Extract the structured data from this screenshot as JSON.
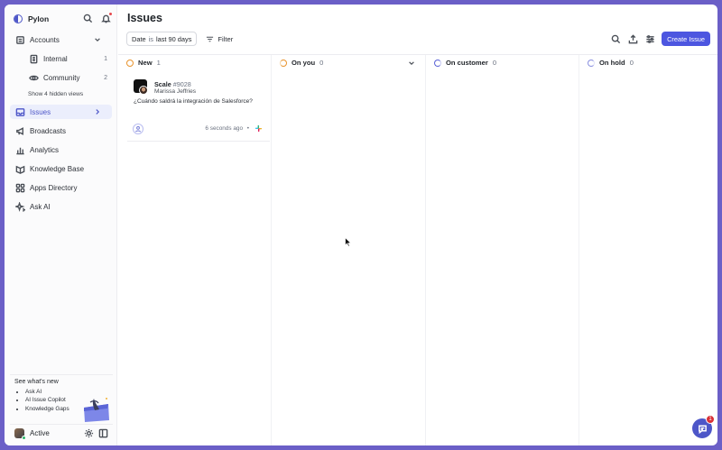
{
  "sidebar": {
    "brand": "Pylon",
    "accounts": {
      "label": "Accounts",
      "views": [
        {
          "label": "Internal",
          "count": "1"
        },
        {
          "label": "Community",
          "count": "2"
        }
      ],
      "hidden_views": "Show 4 hidden views"
    },
    "items": [
      {
        "label": "Issues",
        "icon": "inbox-icon"
      },
      {
        "label": "Broadcasts",
        "icon": "megaphone-icon"
      },
      {
        "label": "Analytics",
        "icon": "bar-chart-icon"
      },
      {
        "label": "Knowledge Base",
        "icon": "book-icon"
      },
      {
        "label": "Apps Directory",
        "icon": "grid-icon"
      },
      {
        "label": "Ask AI",
        "icon": "sparkle-icon"
      }
    ],
    "whats_new": {
      "title": "See what's new",
      "items": [
        "Ask AI",
        "AI Issue Copilot",
        "Knowledge Gaps"
      ]
    },
    "user": {
      "status": "Active"
    }
  },
  "main": {
    "title": "Issues",
    "date_chip": {
      "field": "Date",
      "op": "is",
      "value": "last 90 days"
    },
    "filter_label": "Filter",
    "create_label": "Create Issue",
    "columns": [
      {
        "label": "New",
        "count": "1",
        "color": "#e8932c"
      },
      {
        "label": "On you",
        "count": "0",
        "color": "#e8932c"
      },
      {
        "label": "On customer",
        "count": "0",
        "color": "#5b63d6"
      },
      {
        "label": "On hold",
        "count": "0",
        "color": "#8a90e0"
      }
    ],
    "card": {
      "account": "Scale",
      "number": "#9028",
      "requester": "Marissa Jeffries",
      "body": "¿Cuándo saldrá la integración de Salesforce?",
      "time": "6 seconds ago",
      "separator": "•",
      "channel_icon": "slack-icon"
    }
  },
  "chat": {
    "badge": "1"
  },
  "colors": {
    "accent": "#4d56e0",
    "frame": "#6b5fc7",
    "active_bg": "#ebeefc"
  }
}
